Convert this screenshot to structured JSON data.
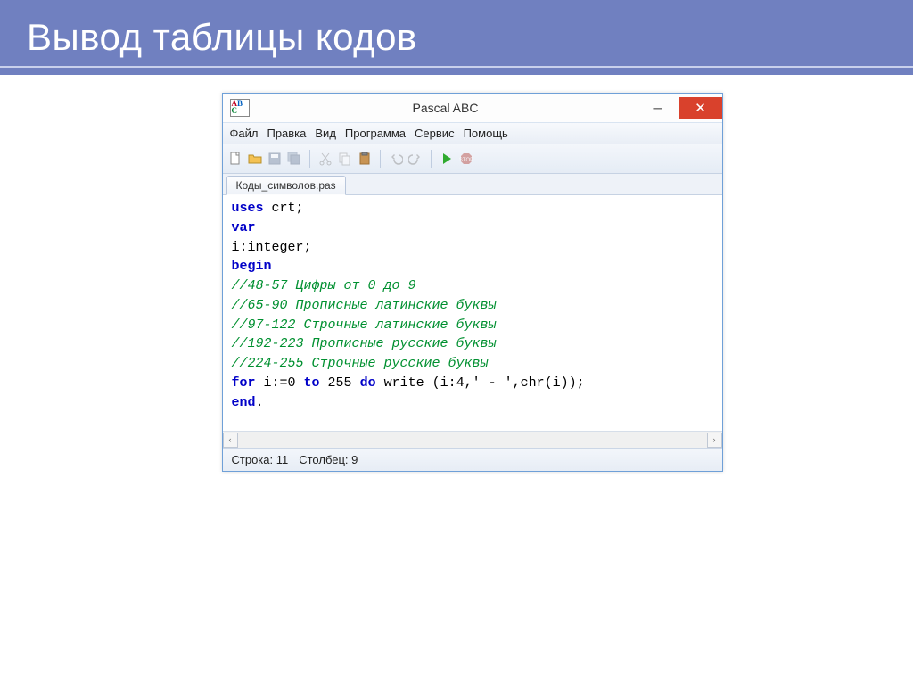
{
  "slide": {
    "title": "Вывод таблицы кодов"
  },
  "window": {
    "title": "Pascal ABC",
    "app_icon": {
      "a": "A",
      "b": "B",
      "c": "C"
    },
    "menus": [
      "Файл",
      "Правка",
      "Вид",
      "Программа",
      "Сервис",
      "Помощь"
    ],
    "tab_label": "Коды_символов.pas",
    "code": {
      "l1_kw": "uses",
      "l1_tx": " crt;",
      "l2_kw": "var",
      "l3": "i:integer;",
      "l4_kw": "begin",
      "l5": "//48-57 Цифры от 0 до 9",
      "l6": "//65-90 Прописные латинские буквы",
      "l7": "//97-122 Строчные латинские буквы",
      "l8": "//192-223 Прописные русские буквы",
      "l9": "//224-255 Строчные русские буквы",
      "l10_kw1": "for",
      "l10_tx1": " i:=0 ",
      "l10_kw2": "to",
      "l10_tx2": " 255 ",
      "l10_kw3": "do",
      "l10_tx3": " write (i:4,' - ',chr(i));",
      "l11_kw": "end",
      "l11_tx": "."
    },
    "status": {
      "line": "Строка: 11",
      "col": "Столбец: 9"
    }
  }
}
